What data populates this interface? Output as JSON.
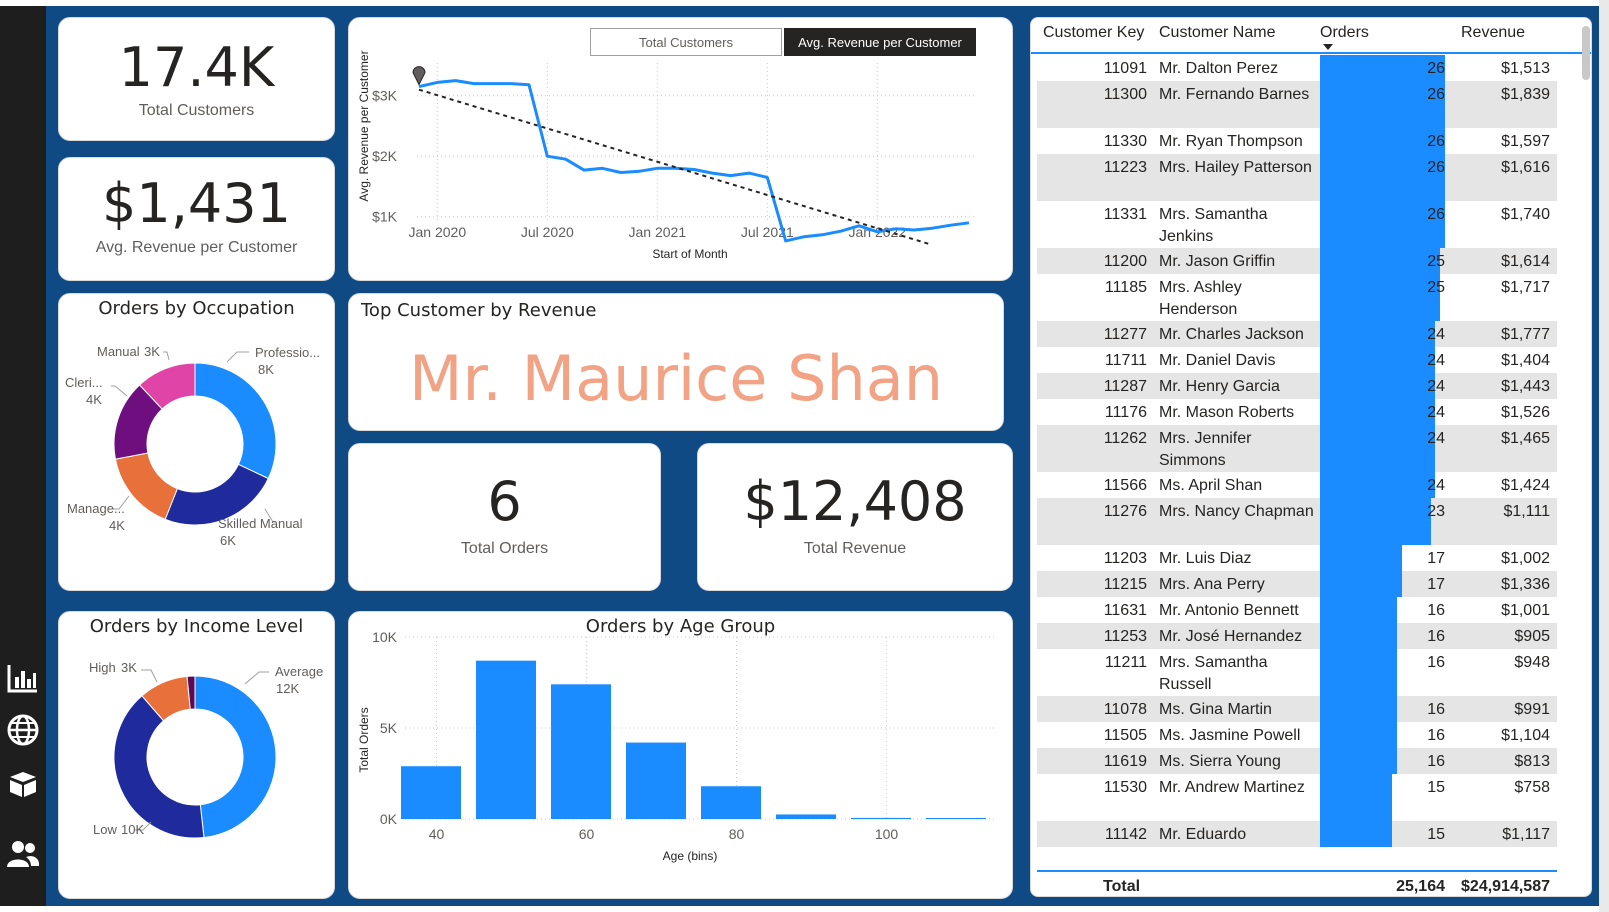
{
  "colors": {
    "background": "#0f4a85",
    "nav": "#1e1e1e",
    "accent_blue": "#1a8cff",
    "dark_navy": "#1f2a9c",
    "orange": "#e8703a",
    "purple": "#6f0f7f",
    "magenta": "#e044a7",
    "dark_purple": "#5b0a5b",
    "highlight_salmon": "#f2a385"
  },
  "nav": {
    "icons": [
      "bar-chart-icon",
      "globe-icon",
      "box-icon",
      "users-icon"
    ]
  },
  "kpis": {
    "total_customers": {
      "value": "17.4K",
      "label": "Total Customers"
    },
    "avg_revenue": {
      "value": "$1,431",
      "label": "Avg. Revenue per Customer"
    },
    "total_orders": {
      "value": "6",
      "label": "Total Orders"
    },
    "total_revenue": {
      "value": "$12,408",
      "label": "Total Revenue"
    }
  },
  "top_customer": {
    "title": "Top Customer by Revenue",
    "name": "Mr. Maurice Shan"
  },
  "trend": {
    "toggles": {
      "total_customers": "Total Customers",
      "avg_revenue": "Avg. Revenue per Customer"
    },
    "active_toggle": "avg_revenue"
  },
  "chart_data": [
    {
      "type": "line",
      "id": "avg_revenue_trend",
      "ylabel": "Avg. Revenue per Customer",
      "xlabel": "Start of Month",
      "x_ticks": [
        "Jan 2020",
        "Jul 2020",
        "Jan 2021",
        "Jul 2021",
        "Jan 2022"
      ],
      "y_ticks": [
        "$1K",
        "$2K",
        "$3K"
      ],
      "ylim": [
        0.4,
        3.4
      ],
      "x": [
        "2019-12",
        "2020-01",
        "2020-02",
        "2020-03",
        "2020-04",
        "2020-05",
        "2020-06",
        "2020-07",
        "2020-08",
        "2020-09",
        "2020-10",
        "2020-11",
        "2020-12",
        "2021-01",
        "2021-02",
        "2021-03",
        "2021-04",
        "2021-05",
        "2021-06",
        "2021-07",
        "2021-08",
        "2021-09",
        "2021-10",
        "2021-11",
        "2021-12",
        "2022-01",
        "2022-02",
        "2022-03",
        "2022-04",
        "2022-05",
        "2022-06"
      ],
      "series": [
        {
          "values": [
            3.15,
            3.22,
            3.25,
            3.2,
            3.2,
            3.2,
            3.18,
            2.0,
            1.95,
            1.77,
            1.8,
            1.73,
            1.75,
            1.8,
            1.8,
            1.78,
            1.72,
            1.68,
            1.72,
            1.65,
            0.6,
            0.67,
            0.7,
            0.76,
            0.85,
            0.75,
            0.8,
            0.78,
            0.81,
            0.86,
            0.9
          ]
        },
        {
          "style": "dashed",
          "values": [
            3.1,
            0.55
          ]
        }
      ],
      "grid": true,
      "legend": "none"
    },
    {
      "type": "pie",
      "id": "orders_by_occupation",
      "title": "Orders by Occupation",
      "categories": [
        "Professio...",
        "Skilled Manual",
        "Manage...",
        "Cleri...",
        "Manual"
      ],
      "value_labels": [
        "8K",
        "6K",
        "4K",
        "4K",
        "3K"
      ],
      "values": [
        8,
        6,
        4,
        4,
        3
      ],
      "colors": [
        "#1a8cff",
        "#1f2a9c",
        "#e8703a",
        "#6f0f7f",
        "#e044a7"
      ]
    },
    {
      "type": "pie",
      "id": "orders_by_income",
      "title": "Orders by Income Level",
      "categories": [
        "Average",
        "Low",
        "High"
      ],
      "value_labels": [
        "12K",
        "10K",
        "3K"
      ],
      "values": [
        12.3,
        10.3,
        2.5,
        0.4
      ],
      "colors": [
        "#1a8cff",
        "#1f2a9c",
        "#e8703a",
        "#5b0a5b"
      ]
    },
    {
      "type": "bar",
      "id": "orders_by_age_group",
      "title": "Orders by Age Group",
      "xlabel": "Age (bins)",
      "ylabel": "Total Orders",
      "x_ticks": [
        "40",
        "60",
        "80",
        "100"
      ],
      "y_ticks": [
        "0K",
        "5K",
        "10K"
      ],
      "categories": [
        40,
        50,
        60,
        70,
        80,
        90,
        100,
        110
      ],
      "values": [
        2900,
        8700,
        7400,
        4200,
        1800,
        250,
        60,
        50
      ],
      "ylim": [
        0,
        10000
      ],
      "xlim": [
        35,
        115
      ],
      "bin_width": 10,
      "grid": true,
      "legend": "none"
    }
  ],
  "table": {
    "headers": {
      "key": "Customer Key",
      "name": "Customer Name",
      "orders": "Orders",
      "revenue": "Revenue"
    },
    "max_orders": 26,
    "rows": [
      {
        "key": "11091",
        "name": "Mr. Dalton Perez",
        "orders": 26,
        "revenue": "$1,513"
      },
      {
        "key": "11300",
        "name": "Mr. Fernando Barnes",
        "orders": 26,
        "revenue": "$1,839"
      },
      {
        "key": "11330",
        "name": "Mr. Ryan Thompson",
        "orders": 26,
        "revenue": "$1,597"
      },
      {
        "key": "11223",
        "name": "Mrs. Hailey Patterson",
        "orders": 26,
        "revenue": "$1,616"
      },
      {
        "key": "11331",
        "name": "Mrs. Samantha Jenkins",
        "orders": 26,
        "revenue": "$1,740"
      },
      {
        "key": "11200",
        "name": "Mr. Jason Griffin",
        "orders": 25,
        "revenue": "$1,614"
      },
      {
        "key": "11185",
        "name": "Mrs. Ashley Henderson",
        "orders": 25,
        "revenue": "$1,717"
      },
      {
        "key": "11277",
        "name": "Mr. Charles Jackson",
        "orders": 24,
        "revenue": "$1,777"
      },
      {
        "key": "11711",
        "name": "Mr. Daniel Davis",
        "orders": 24,
        "revenue": "$1,404"
      },
      {
        "key": "11287",
        "name": "Mr. Henry Garcia",
        "orders": 24,
        "revenue": "$1,443"
      },
      {
        "key": "11176",
        "name": "Mr. Mason Roberts",
        "orders": 24,
        "revenue": "$1,526"
      },
      {
        "key": "11262",
        "name": "Mrs. Jennifer Simmons",
        "orders": 24,
        "revenue": "$1,465"
      },
      {
        "key": "11566",
        "name": "Ms. April Shan",
        "orders": 24,
        "revenue": "$1,424"
      },
      {
        "key": "11276",
        "name": "Mrs. Nancy Chapman",
        "orders": 23,
        "revenue": "$1,111"
      },
      {
        "key": "11203",
        "name": "Mr. Luis Diaz",
        "orders": 17,
        "revenue": "$1,002"
      },
      {
        "key": "11215",
        "name": "Mrs. Ana Perry",
        "orders": 17,
        "revenue": "$1,336"
      },
      {
        "key": "11631",
        "name": "Mr. Antonio Bennett",
        "orders": 16,
        "revenue": "$1,001"
      },
      {
        "key": "11253",
        "name": "Mr. José Hernandez",
        "orders": 16,
        "revenue": "$905"
      },
      {
        "key": "11211",
        "name": "Mrs. Samantha Russell",
        "orders": 16,
        "revenue": "$948"
      },
      {
        "key": "11078",
        "name": "Ms. Gina Martin",
        "orders": 16,
        "revenue": "$991"
      },
      {
        "key": "11505",
        "name": "Ms. Jasmine Powell",
        "orders": 16,
        "revenue": "$1,104"
      },
      {
        "key": "11619",
        "name": "Ms. Sierra Young",
        "orders": 16,
        "revenue": "$813"
      },
      {
        "key": "11530",
        "name": "Mr. Andrew Martinez",
        "orders": 15,
        "revenue": "$758"
      },
      {
        "key": "11142",
        "name": "Mr. Eduardo",
        "orders": 15,
        "revenue": "$1,117"
      }
    ],
    "footer": {
      "label": "Total",
      "orders": "25,164",
      "revenue": "$24,914,587"
    }
  }
}
